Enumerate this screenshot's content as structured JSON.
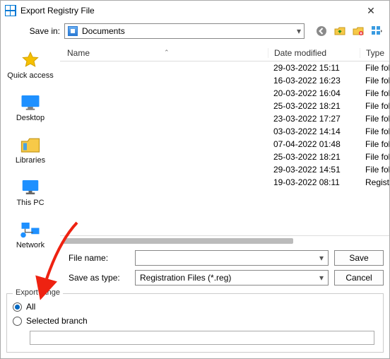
{
  "window": {
    "title": "Export Registry File"
  },
  "savein": {
    "label": "Save in:",
    "value": "Documents"
  },
  "navicons": {
    "back": "back-icon",
    "up": "folder-up-icon",
    "newfolder": "new-folder-icon",
    "views": "views-icon"
  },
  "places": [
    {
      "key": "quick-access",
      "label": "Quick access"
    },
    {
      "key": "desktop",
      "label": "Desktop"
    },
    {
      "key": "libraries",
      "label": "Libraries"
    },
    {
      "key": "this-pc",
      "label": "This PC"
    },
    {
      "key": "network",
      "label": "Network"
    }
  ],
  "columns": {
    "name": "Name",
    "date": "Date modified",
    "type": "Type"
  },
  "rows": [
    {
      "name": "",
      "date": "29-03-2022 15:11",
      "type": "File folder"
    },
    {
      "name": "",
      "date": "16-03-2022 16:23",
      "type": "File folder"
    },
    {
      "name": "",
      "date": "20-03-2022 16:04",
      "type": "File folder"
    },
    {
      "name": "",
      "date": "25-03-2022 18:21",
      "type": "File folder"
    },
    {
      "name": "",
      "date": "23-03-2022 17:27",
      "type": "File folder"
    },
    {
      "name": "",
      "date": "03-03-2022 14:14",
      "type": "File folder"
    },
    {
      "name": "",
      "date": "07-04-2022 01:48",
      "type": "File folder"
    },
    {
      "name": "",
      "date": "25-03-2022 18:21",
      "type": "File folder"
    },
    {
      "name": "",
      "date": "29-03-2022 14:51",
      "type": "File folder"
    },
    {
      "name": "",
      "date": "19-03-2022 08:11",
      "type": "Registration Entries"
    }
  ],
  "form": {
    "file_name_label": "File name:",
    "file_name_value": "",
    "save_as_type_label": "Save as type:",
    "save_as_type_value": "Registration Files (*.reg)",
    "save_button": "Save",
    "cancel_button": "Cancel"
  },
  "export": {
    "legend": "Export range",
    "all_label": "All",
    "selected_label": "Selected branch",
    "selected_value": ""
  }
}
